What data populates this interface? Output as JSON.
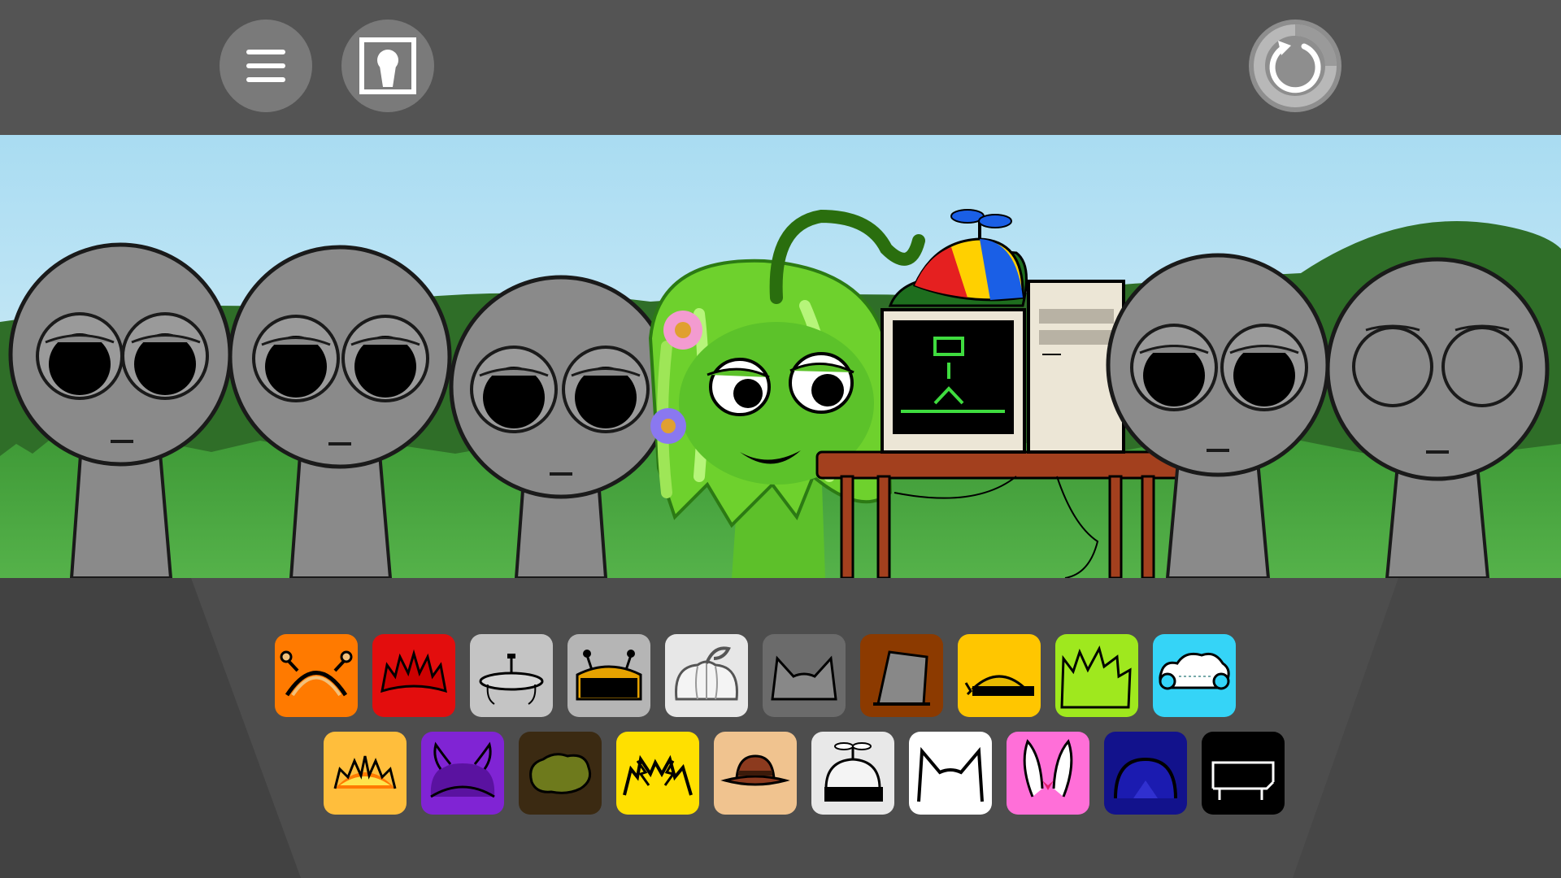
{
  "toolbar": {
    "menu_icon": "hamburger-menu-icon",
    "gallery_icon": "character-portrait-icon",
    "reset_icon": "reset-loop-icon",
    "button_color": "#7a7a7a"
  },
  "scene": {
    "sky_top": "#a9dcf2",
    "sky_bottom": "#d9f0f7",
    "grass": "#3f9a37",
    "hills": "#2f6e28",
    "characters": [
      {
        "id": "gray-1",
        "state": "idle"
      },
      {
        "id": "gray-2",
        "state": "idle"
      },
      {
        "id": "gray-3",
        "state": "idle"
      },
      {
        "id": "green-vine",
        "state": "active"
      },
      {
        "id": "computer-desk",
        "state": "active"
      },
      {
        "id": "gray-4",
        "state": "idle"
      },
      {
        "id": "gray-5",
        "state": "eyes-empty"
      }
    ]
  },
  "palette": {
    "row1": [
      {
        "name": "antenna-headband-icon",
        "bg": "#ff7a00"
      },
      {
        "name": "spiky-red-hair-icon",
        "bg": "#e30d0d"
      },
      {
        "name": "halo-disc-icon",
        "bg": "#c4c4c4"
      },
      {
        "name": "robot-visor-icon",
        "bg": "#b5b5b5"
      },
      {
        "name": "pumpkin-head-icon",
        "bg": "#e7e7e7"
      },
      {
        "name": "cat-ears-gray-icon",
        "bg": "#6b6b6b"
      },
      {
        "name": "bucket-hat-icon",
        "bg": "#8c3a00"
      },
      {
        "name": "yellow-visor-cap-icon",
        "bg": "#ffc600"
      },
      {
        "name": "lime-spiky-hair-icon",
        "bg": "#9fe81e"
      },
      {
        "name": "cloud-headphones-icon",
        "bg": "#35d4f7"
      }
    ],
    "row2": [
      {
        "name": "sun-crown-icon",
        "bg": "#ffbe3c"
      },
      {
        "name": "purple-horns-icon",
        "bg": "#8024d4"
      },
      {
        "name": "moss-bush-icon",
        "bg": "#3b2a12"
      },
      {
        "name": "lightning-hair-icon",
        "bg": "#ffe000"
      },
      {
        "name": "fedora-hat-icon",
        "bg": "#f0c38f"
      },
      {
        "name": "propeller-cap-icon",
        "bg": "#e8e8e8"
      },
      {
        "name": "white-cat-ears-icon",
        "bg": "#ffffff"
      },
      {
        "name": "bunny-ears-icon",
        "bg": "#ff6fd8"
      },
      {
        "name": "blue-dome-icon",
        "bg": "#12128c"
      },
      {
        "name": "bench-icon",
        "bg": "#000000"
      }
    ]
  }
}
